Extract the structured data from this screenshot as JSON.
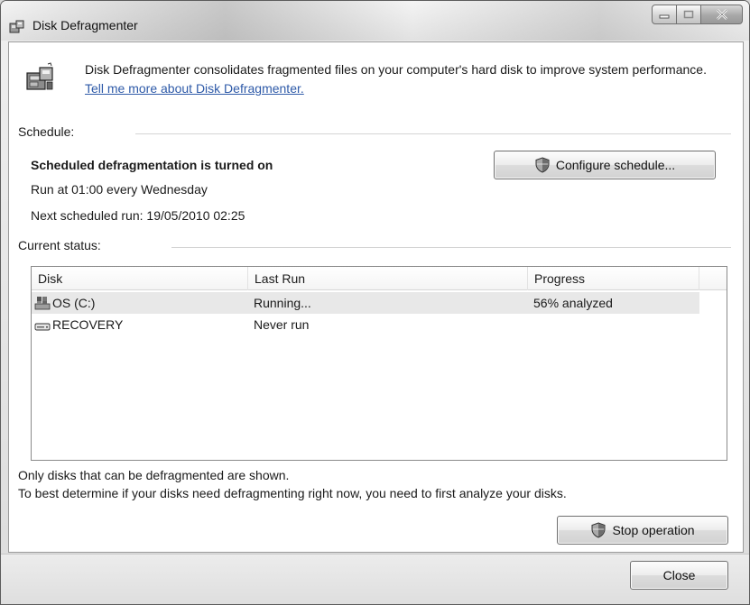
{
  "window": {
    "title": "Disk Defragmenter"
  },
  "intro": {
    "text": "Disk Defragmenter consolidates fragmented files on your computer's hard disk to improve system performance. ",
    "link": "Tell me more about Disk Defragmenter."
  },
  "schedule": {
    "label": "Schedule:",
    "status": "Scheduled defragmentation is turned on",
    "run_at": "Run at 01:00 every Wednesday",
    "next_run": "Next scheduled run: 19/05/2010 02:25",
    "configure_button": "Configure schedule..."
  },
  "current_status": {
    "label": "Current status:",
    "columns": [
      "Disk",
      "Last Run",
      "Progress"
    ],
    "rows": [
      {
        "disk": "OS (C:)",
        "last_run": "Running...",
        "progress": "56% analyzed",
        "icon": "system-drive-icon",
        "selected": true
      },
      {
        "disk": "RECOVERY",
        "last_run": "Never run",
        "progress": "",
        "icon": "hard-drive-icon",
        "selected": false
      }
    ]
  },
  "notes": {
    "line1": "Only disks that can be defragmented are shown.",
    "line2": "To best determine if your disks need defragmenting right now, you need to first analyze your disks."
  },
  "buttons": {
    "stop": "Stop operation",
    "close": "Close"
  }
}
